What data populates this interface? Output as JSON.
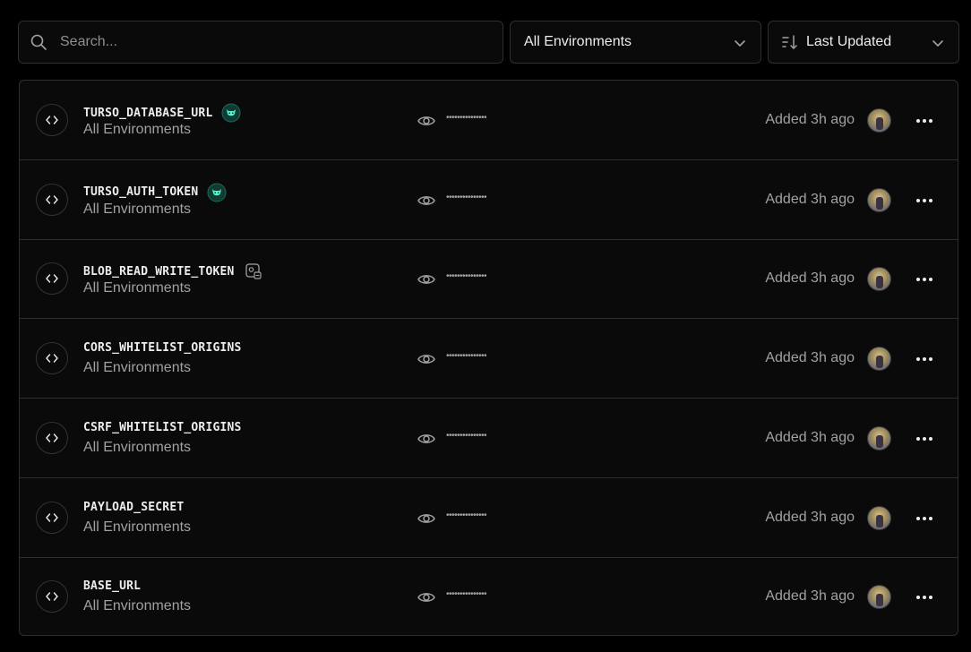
{
  "search": {
    "placeholder": "Search..."
  },
  "filters": {
    "environment_label": "All Environments",
    "sort_label": "Last Updated"
  },
  "variables": [
    {
      "name": "TURSO_DATABASE_URL",
      "environment": "All Environments",
      "masked_value": "•••••••••••••••",
      "added": "Added 3h ago",
      "badge": "turso-integration-icon"
    },
    {
      "name": "TURSO_AUTH_TOKEN",
      "environment": "All Environments",
      "masked_value": "•••••••••••••••",
      "added": "Added 3h ago",
      "badge": "turso-integration-icon"
    },
    {
      "name": "BLOB_READ_WRITE_TOKEN",
      "environment": "All Environments",
      "masked_value": "•••••••••••••••",
      "added": "Added 3h ago",
      "badge": "blob-storage-icon"
    },
    {
      "name": "CORS_WHITELIST_ORIGINS",
      "environment": "All Environments",
      "masked_value": "•••••••••••••••",
      "added": "Added 3h ago",
      "badge": ""
    },
    {
      "name": "CSRF_WHITELIST_ORIGINS",
      "environment": "All Environments",
      "masked_value": "•••••••••••••••",
      "added": "Added 3h ago",
      "badge": ""
    },
    {
      "name": "PAYLOAD_SECRET",
      "environment": "All Environments",
      "masked_value": "•••••••••••••••",
      "added": "Added 3h ago",
      "badge": ""
    },
    {
      "name": "BASE_URL",
      "environment": "All Environments",
      "masked_value": "•••••••••••••••",
      "added": "Added 3h ago",
      "badge": ""
    }
  ],
  "colors": {
    "background": "#000000",
    "surface": "#0a0a0a",
    "border": "#2e2e2e",
    "text_primary": "#ededed",
    "text_secondary": "#a1a1a1",
    "turso_accent": "#4ff8d2"
  }
}
